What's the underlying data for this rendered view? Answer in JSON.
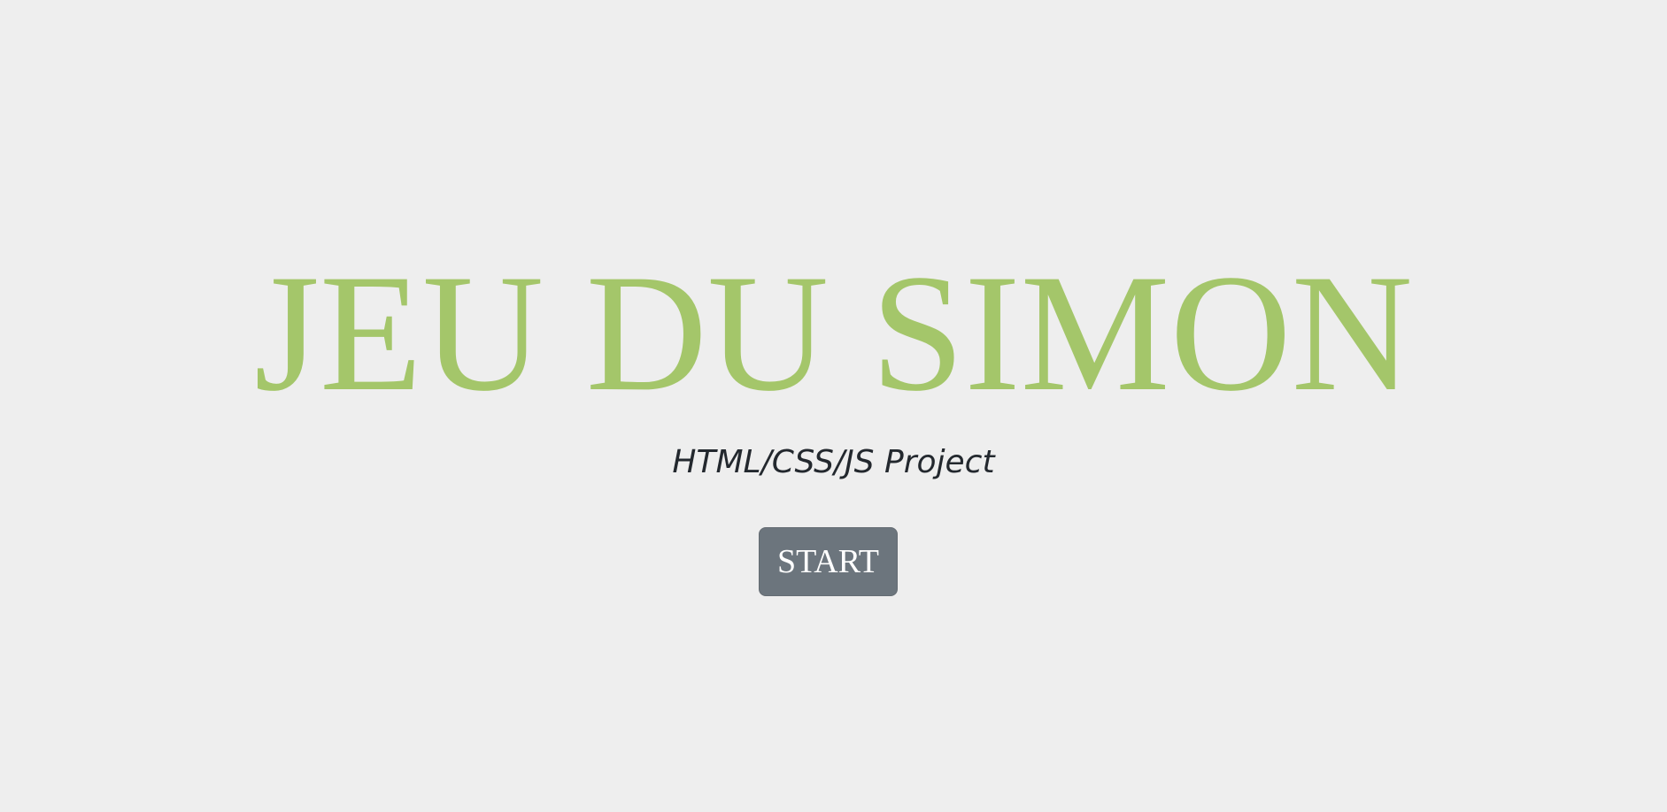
{
  "page": {
    "title": "JEU DU SIMON",
    "subtitle": "HTML/CSS/JS Project",
    "start_label": "START"
  },
  "colors": {
    "background": "#eeeeee",
    "title": "#a4c66a",
    "subtitle": "#23282e",
    "button_background": "#6c757d",
    "button_text": "#ffffff"
  }
}
